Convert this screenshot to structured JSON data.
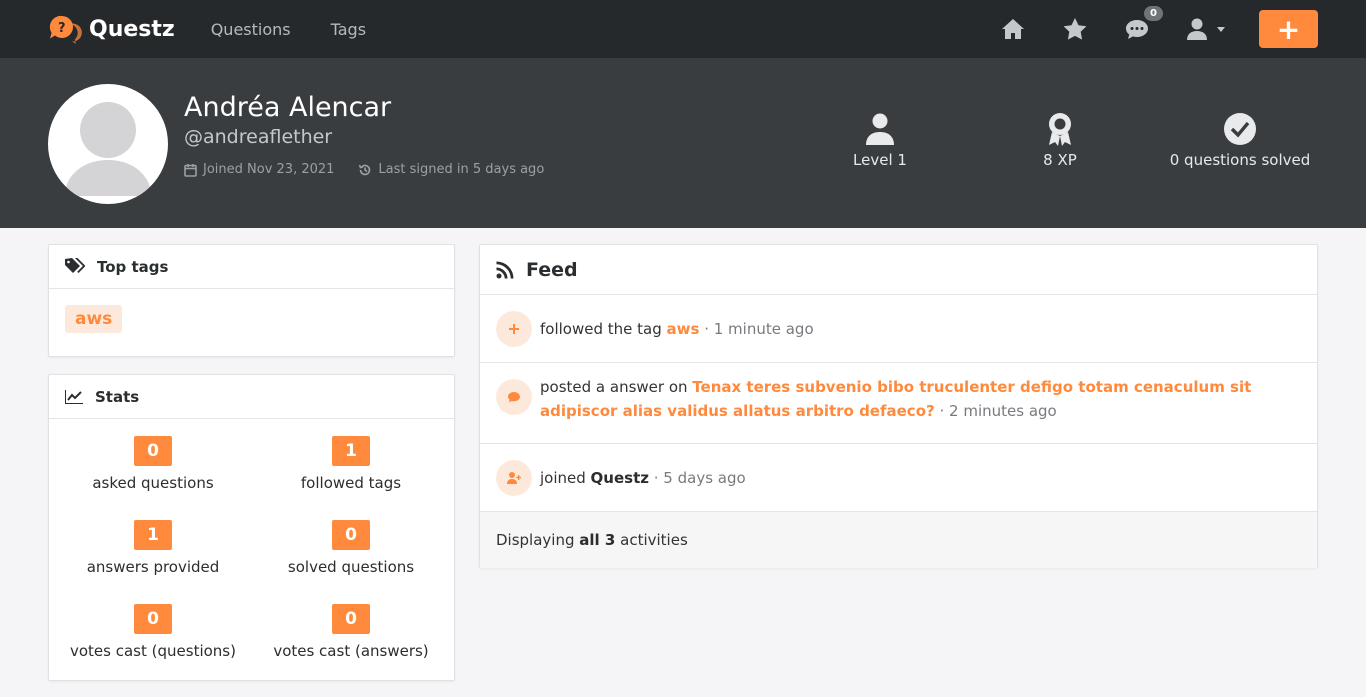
{
  "navbar": {
    "brand": "Questz",
    "links": [
      "Questions",
      "Tags"
    ],
    "notification_count": "0",
    "add_label": "+"
  },
  "profile": {
    "name": "Andréa Alencar",
    "handle": "@andreaflether",
    "joined": "Joined Nov 23, 2021",
    "last_signed": "Last signed in 5 days ago",
    "level": "Level 1",
    "xp": "8 XP",
    "solved": "0 questions solved"
  },
  "top_tags": {
    "title": "Top tags",
    "tags": [
      "aws"
    ]
  },
  "stats": {
    "title": "Stats",
    "items": [
      {
        "value": "0",
        "label": "asked questions"
      },
      {
        "value": "1",
        "label": "followed tags"
      },
      {
        "value": "1",
        "label": "answers provided"
      },
      {
        "value": "0",
        "label": "solved questions"
      },
      {
        "value": "0",
        "label": "votes cast (questions)"
      },
      {
        "value": "0",
        "label": "votes cast (answers)"
      }
    ]
  },
  "feed": {
    "title": "Feed",
    "items": [
      {
        "prefix": "followed the tag ",
        "link": "aws",
        "sep": " · ",
        "time": "1 minute ago",
        "icon": "plus-icon"
      },
      {
        "prefix": "posted a answer on ",
        "link": "Tenax teres subvenio bibo truculenter defigo totam cenaculum sit adipiscor alias validus allatus arbitro defaeco?",
        "sep": " · ",
        "time": "2 minutes ago",
        "icon": "comment-icon"
      },
      {
        "prefix": "joined ",
        "link": "Questz",
        "sep": " · ",
        "time": "5 days ago",
        "icon": "user-plus-icon"
      }
    ],
    "footer_prefix": "Displaying ",
    "footer_bold": "all 3",
    "footer_suffix": " activities"
  },
  "colors": {
    "accent": "#ff8a3d",
    "navbar": "#26292b",
    "hero": "#3a3d40"
  }
}
